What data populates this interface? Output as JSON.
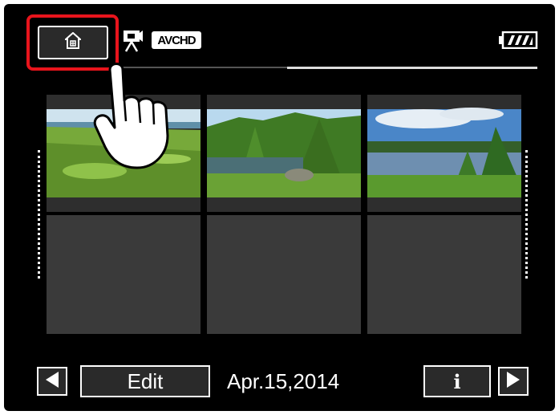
{
  "header": {
    "home_icon": "home-icon",
    "mode_icon": "movie-camera-icon",
    "format_badge": "AVCHD",
    "battery_icon": "battery-full-icon",
    "highlight_color": "#e8141c"
  },
  "index": {
    "thumbnails": [
      {
        "scene": "golf-course-by-sea"
      },
      {
        "scene": "pond-with-trees"
      },
      {
        "scene": "lake-under-blue-sky"
      },
      {
        "scene": "empty"
      },
      {
        "scene": "empty"
      },
      {
        "scene": "empty"
      }
    ]
  },
  "footer": {
    "prev_icon": "triangle-left-icon",
    "edit_label": "Edit",
    "date": "Apr.15,2014",
    "info_label": "i",
    "next_icon": "triangle-right-icon"
  }
}
